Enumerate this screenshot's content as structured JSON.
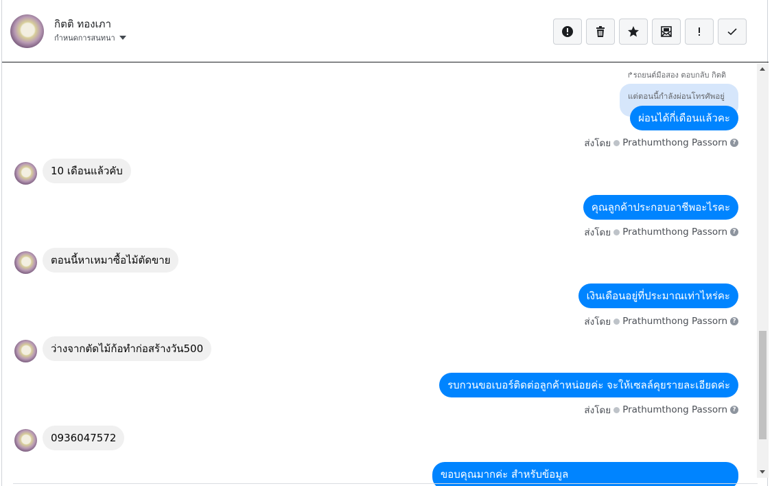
{
  "header": {
    "contact_name": "กิตติ ทองเภา",
    "subtitle": "กำหนดการสนทนา",
    "actions": [
      {
        "icon": "alert-circle-icon",
        "name": "flag-button"
      },
      {
        "icon": "trash-icon",
        "name": "delete-button"
      },
      {
        "icon": "star-icon",
        "name": "star-button"
      },
      {
        "icon": "mail-unread-icon",
        "name": "mark-unread-button"
      },
      {
        "icon": "exclamation-icon",
        "name": "spam-button"
      },
      {
        "icon": "check-icon",
        "name": "done-button"
      }
    ]
  },
  "chat": {
    "reply_meta": "รถยนต์มือสอง ตอบกลับ กิตติ",
    "reply_quote": "แต่ตอนนี้กำลังผ่อนโทรศัพอยู่",
    "sent_by_label": "ส่งโดย",
    "sender_name": "Prathumthong Passorn",
    "messages": [
      {
        "dir": "out",
        "text": "ผ่อนได้กี่เดือนแล้วคะ"
      },
      {
        "dir": "in",
        "text": "10 เดือนแล้วคับ"
      },
      {
        "dir": "out",
        "text": "คุณลูกค้าประกอบอาชีพอะไรคะ"
      },
      {
        "dir": "in",
        "text": "ตอนนี้หาเหมาซื้อไม้ตัดขาย"
      },
      {
        "dir": "out",
        "text": "เงินเดือนอยู่ที่ประมาณเท่าไหร่คะ"
      },
      {
        "dir": "in",
        "text": "ว่างจากตัดไม้ก้อทำก่อสร้างวัน500"
      },
      {
        "dir": "out",
        "text": "รบกวนขอเบอร์ติดต่อลูกค้าหน่อยค่ะ จะให้เซลล์คุยรายละเอียดค่ะ"
      },
      {
        "dir": "in",
        "text": "0936047572"
      },
      {
        "dir": "out",
        "text": "ขอบคุณมากค่ะ สำหรับข้อมูล"
      }
    ]
  },
  "colors": {
    "outgoing_bubble": "#0084ff",
    "incoming_bubble": "#f0f0f0",
    "reply_quote_bg": "#d6e6fb"
  }
}
